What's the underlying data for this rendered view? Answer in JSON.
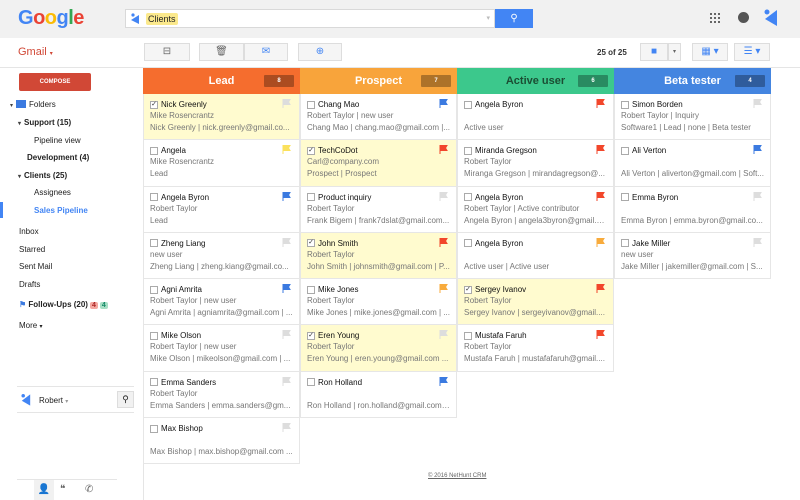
{
  "header": {
    "logo": "Google",
    "search_chip": "Clients"
  },
  "toolbar": {
    "gmail_label": "Gmail",
    "count": "25 of 25"
  },
  "sidebar": {
    "compose": "COMPOSE",
    "items": [
      {
        "label": "Folders"
      },
      {
        "label": "Support (15)"
      },
      {
        "label": "Pipeline view"
      },
      {
        "label": "Development (4)"
      },
      {
        "label": "Clients (25)"
      },
      {
        "label": "Assignees"
      },
      {
        "label": "Sales Pipeline"
      },
      {
        "label": "Inbox"
      },
      {
        "label": "Starred"
      },
      {
        "label": "Sent Mail"
      },
      {
        "label": "Drafts"
      },
      {
        "label": "Follow-Ups (20)"
      },
      {
        "label": "More"
      }
    ],
    "followup_badges": [
      "4",
      "4"
    ],
    "user": "Robert"
  },
  "colors": {
    "lead": "#f56d2e",
    "prospect": "#f8a43b",
    "active": "#3cc88c",
    "beta": "#4485e0",
    "flag_red": "#f2462b",
    "flag_blue": "#3b7ae0",
    "flag_grey": "#dddddd",
    "flag_yellow": "#fbe15c",
    "flag_orange": "#f8ab3c"
  },
  "columns": [
    {
      "title": "Lead",
      "count": "8",
      "color": "#f56d2e",
      "cards": [
        {
          "name": "Nick Greenly",
          "checked": true,
          "flag": "grey",
          "l1": "Mike Rosencrantz",
          "l2": "Nick Greenly | nick.greenly@gmail.co..."
        },
        {
          "name": "Angela",
          "checked": false,
          "flag": "yellow",
          "l1": "Mike Rosencrantz",
          "l2": "Lead"
        },
        {
          "name": "Angela Byron",
          "checked": false,
          "flag": "blue",
          "l1": "Robert Taylor",
          "l2": "Lead"
        },
        {
          "name": "Zheng Liang",
          "checked": false,
          "flag": "grey",
          "l1": "new user",
          "l2": "Zheng Liang | zheng.kiang@gmail.co..."
        },
        {
          "name": "Agni Amrita",
          "checked": false,
          "flag": "blue",
          "l1": "Robert Taylor | new user",
          "l2": "Agni Amrita | agniamrita@gmail.com | ..."
        },
        {
          "name": "Mike Olson",
          "checked": false,
          "flag": "grey",
          "l1": "Robert Taylor | new user",
          "l2": "Mike Olson | mikeolson@gmail.com | ..."
        },
        {
          "name": "Emma Sanders",
          "checked": false,
          "flag": "grey",
          "l1": "Robert Taylor",
          "l2": "Emma Sanders | emma.sanders@gm..."
        },
        {
          "name": "Max Bishop",
          "checked": false,
          "flag": "grey",
          "l1": "",
          "l2": "Max Bishop | max.bishop@gmail.com ..."
        }
      ]
    },
    {
      "title": "Prospect",
      "count": "7",
      "color": "#f8a43b",
      "cards": [
        {
          "name": "Chang Mao",
          "checked": false,
          "flag": "blue",
          "l1": "Robert Taylor | new user",
          "l2": "Chang Mao | chang.mao@gmail.com |..."
        },
        {
          "name": "TechCoDot",
          "checked": true,
          "flag": "red",
          "l1": "Carl@company.com",
          "l2": "Prospect | Prospect"
        },
        {
          "name": "Product inquiry",
          "checked": false,
          "flag": "grey",
          "l1": "Robert Taylor",
          "l2": "Frank Bigem | frank7dslat@gmail.com..."
        },
        {
          "name": "John Smith",
          "checked": true,
          "flag": "red",
          "l1": "Robert Taylor",
          "l2": "John Smith | johnsmith@gmail.com | P..."
        },
        {
          "name": "Mike Jones",
          "checked": false,
          "flag": "orange",
          "l1": "Robert Taylor",
          "l2": "Mike Jones | mike.jones@gmail.com | ..."
        },
        {
          "name": "Eren Young",
          "checked": true,
          "flag": "grey",
          "l1": "Robert Taylor",
          "l2": "Eren Young | eren.young@gmail.com ..."
        },
        {
          "name": "Ron Holland",
          "checked": false,
          "flag": "blue",
          "l1": "",
          "l2": "Ron Holland | ron.holland@gmail.com ..."
        }
      ]
    },
    {
      "title": "Active user",
      "count": "6",
      "color": "#3cc88c",
      "cards": [
        {
          "name": "Angela Byron",
          "checked": false,
          "flag": "red",
          "l1": "",
          "l2": "Active user"
        },
        {
          "name": "Miranda Gregson",
          "checked": false,
          "flag": "red",
          "l1": "Robert Taylor",
          "l2": "Miranga Gregson | mirandagregson@..."
        },
        {
          "name": "Angela Byron",
          "checked": false,
          "flag": "red",
          "l1": "Robert Taylor | Active contributor",
          "l2": "Angela Byron | angela3byron@gmail.c..."
        },
        {
          "name": "Angela Byron",
          "checked": false,
          "flag": "orange",
          "l1": "",
          "l2": "Active user | Active user"
        },
        {
          "name": "Sergey Ivanov",
          "checked": true,
          "flag": "red",
          "l1": "Robert Taylor",
          "l2": "Sergey Ivanov | sergeyivanov@gmail...."
        },
        {
          "name": "Mustafa Faruh",
          "checked": false,
          "flag": "red",
          "l1": "Robert Taylor",
          "l2": "Mustafa Faruh | mustafafaruh@gmail...."
        }
      ]
    },
    {
      "title": "Beta tester",
      "count": "4",
      "color": "#4485e0",
      "cards": [
        {
          "name": "Simon Borden",
          "checked": false,
          "flag": "grey",
          "l1": "Robert Taylor | Inquiry",
          "l2": "Software1 | Lead | none | Beta tester"
        },
        {
          "name": "Ali Verton",
          "checked": false,
          "flag": "blue",
          "l1": "",
          "l2": "Ali Verton | aliverton@gmail.com | Soft..."
        },
        {
          "name": "Emma Byron",
          "checked": false,
          "flag": "grey",
          "l1": "",
          "l2": "Emma Byron | emma.byron@gmail.co..."
        },
        {
          "name": "Jake Miller",
          "checked": false,
          "flag": "grey",
          "l1": "new user",
          "l2": "Jake Miller | jakemiller@gmail.com | S..."
        }
      ]
    }
  ],
  "footer": "© 2016 NetHunt CRM"
}
